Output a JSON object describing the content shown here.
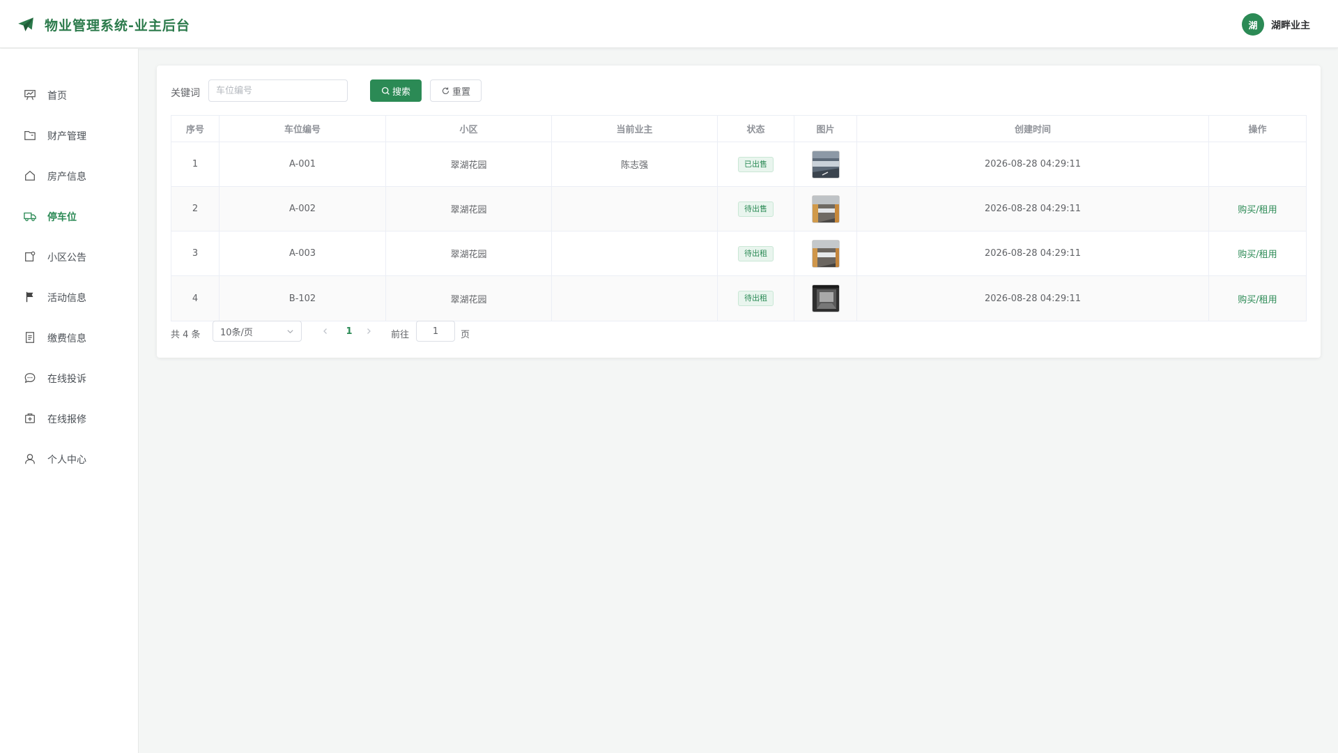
{
  "header": {
    "title": "物业管理系统-业主后台",
    "avatar_text": "湖",
    "username": "湖畔业主"
  },
  "sidebar": {
    "items": [
      {
        "label": "首页",
        "icon": "dashboard-icon"
      },
      {
        "label": "财产管理",
        "icon": "folder-icon"
      },
      {
        "label": "房产信息",
        "icon": "house-icon"
      },
      {
        "label": "停车位",
        "icon": "truck-icon",
        "active": true
      },
      {
        "label": "小区公告",
        "icon": "notice-icon"
      },
      {
        "label": "活动信息",
        "icon": "flag-icon"
      },
      {
        "label": "缴费信息",
        "icon": "document-icon"
      },
      {
        "label": "在线投诉",
        "icon": "chat-icon"
      },
      {
        "label": "在线报修",
        "icon": "repair-icon"
      },
      {
        "label": "个人中心",
        "icon": "user-icon"
      }
    ]
  },
  "search": {
    "label": "关键词",
    "placeholder": "车位编号",
    "value": "",
    "search_button": "搜索",
    "reset_button": "重置"
  },
  "table": {
    "columns": [
      "序号",
      "车位编号",
      "小区",
      "当前业主",
      "状态",
      "图片",
      "创建时间",
      "操作"
    ],
    "rows": [
      {
        "index": "1",
        "code": "A-001",
        "community": "翠湖花园",
        "owner": "陈志强",
        "status": "已出售",
        "created": "2026-08-28 04:29:11",
        "action": ""
      },
      {
        "index": "2",
        "code": "A-002",
        "community": "翠湖花园",
        "owner": "",
        "status": "待出售",
        "created": "2026-08-28 04:29:11",
        "action": "购买/租用"
      },
      {
        "index": "3",
        "code": "A-003",
        "community": "翠湖花园",
        "owner": "",
        "status": "待出租",
        "created": "2026-08-28 04:29:11",
        "action": "购买/租用"
      },
      {
        "index": "4",
        "code": "B-102",
        "community": "翠湖花园",
        "owner": "",
        "status": "待出租",
        "created": "2026-08-28 04:29:11",
        "action": "购买/租用"
      }
    ]
  },
  "pagination": {
    "total_text": "共 4 条",
    "page_size": "10条/页",
    "current_page": "1",
    "goto_label": "前往",
    "goto_value": "1",
    "page_suffix": "页"
  },
  "colors": {
    "accent": "#2b8a55",
    "title": "#2b7a4b",
    "background": "#f4f6f5"
  }
}
